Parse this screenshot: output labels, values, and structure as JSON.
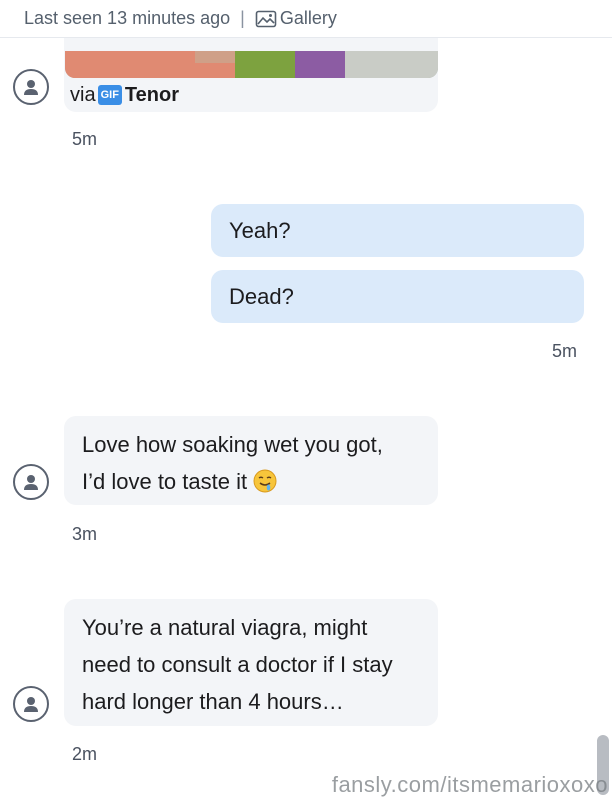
{
  "header": {
    "last_seen": "Last seen 13 minutes ago",
    "separator": "|",
    "gallery_label": "Gallery"
  },
  "messages": [
    {
      "type": "gif",
      "attribution_prefix": "via",
      "gif_badge": "GIF",
      "provider": "Tenor",
      "time": "5m"
    },
    {
      "type": "outgoing",
      "text": "Yeah?"
    },
    {
      "type": "outgoing",
      "text": "Dead?",
      "time": "5m"
    },
    {
      "type": "incoming",
      "line1": "Love how soaking wet you got,",
      "line2": "I’d love to taste it",
      "emoji": "drooling-face",
      "time": "3m"
    },
    {
      "type": "incoming",
      "line1": "You’re a natural viagra, might",
      "line2": "need to consult a doctor if I stay",
      "line3": "hard longer than 4 hours…",
      "time": "2m"
    }
  ],
  "watermark": "fansly.com/itsmemarioxoxo",
  "colors": {
    "incoming_bubble": "#f3f5f8",
    "outgoing_bubble": "#dbeafa",
    "avatar_stroke": "#5a6270"
  }
}
